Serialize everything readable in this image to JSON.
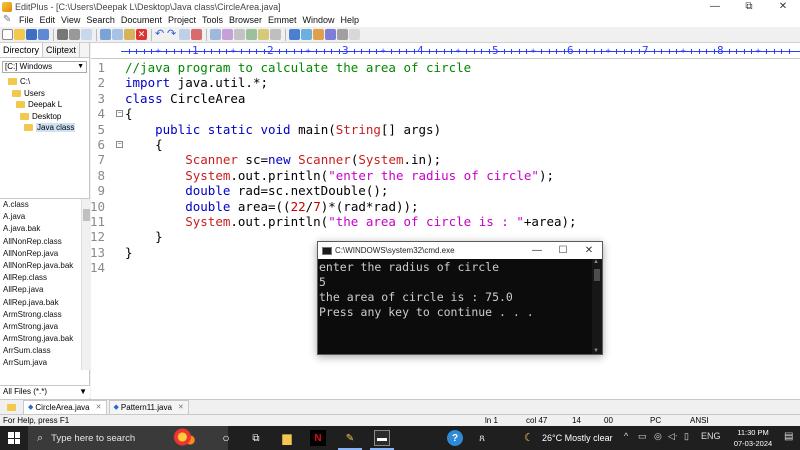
{
  "window": {
    "title": "EditPlus - [C:\\Users\\Deepak L\\Desktop\\Java class\\CircleArea.java]",
    "buttons": [
      "—",
      "⧉",
      "✕"
    ]
  },
  "menubar": [
    "File",
    "Edit",
    "View",
    "Search",
    "Document",
    "Project",
    "Tools",
    "Browser",
    "Emmet",
    "Window",
    "Help"
  ],
  "left_panel": {
    "tabs": [
      "Directory",
      "Cliptext"
    ],
    "drive": "[C:] Windows",
    "tree": [
      {
        "label": "C:\\",
        "indent": 0
      },
      {
        "label": "Users",
        "indent": 1
      },
      {
        "label": "Deepak L",
        "indent": 2
      },
      {
        "label": "Desktop",
        "indent": 3
      },
      {
        "label": "Java class",
        "indent": 4,
        "selected": true
      }
    ],
    "files": [
      "A.class",
      "A.java",
      "A.java.bak",
      "AllNonRep.class",
      "AllNonRep.java",
      "AllNonRep.java.bak",
      "AllRep.class",
      "AllRep.java",
      "AllRep.java.bak",
      "ArmStrong.class",
      "ArmStrong.java",
      "ArmStrong.java.bak",
      "ArrSum.class",
      "ArrSum.java"
    ],
    "filter": "All Files (*.*)"
  },
  "ruler": {
    "numbers": [
      "1",
      "2",
      "3",
      "4",
      "5",
      "6",
      "7",
      "8"
    ]
  },
  "editor": {
    "line_numbers": [
      "1",
      "2",
      "3",
      "4",
      "5",
      "6",
      "7",
      "8",
      "9",
      "10",
      "11",
      "12",
      "13",
      "14"
    ],
    "fold_lines": [
      4,
      6
    ],
    "lines": [
      [
        {
          "t": "//java program to calculate the area of circle",
          "c": "cmt"
        }
      ],
      [
        {
          "t": "import",
          "c": "kw"
        },
        {
          "t": " java.util.*;",
          "c": ""
        }
      ],
      [
        {
          "t": "class",
          "c": "kw"
        },
        {
          "t": " CircleArea",
          "c": ""
        }
      ],
      [
        {
          "t": "{",
          "c": ""
        }
      ],
      [
        {
          "t": "    ",
          "c": ""
        },
        {
          "t": "public",
          "c": "kw"
        },
        {
          "t": " ",
          "c": ""
        },
        {
          "t": "static",
          "c": "kw"
        },
        {
          "t": " ",
          "c": ""
        },
        {
          "t": "void",
          "c": "kw"
        },
        {
          "t": " main(",
          "c": ""
        },
        {
          "t": "String",
          "c": "cls"
        },
        {
          "t": "[] args)",
          "c": ""
        }
      ],
      [
        {
          "t": "    {",
          "c": ""
        }
      ],
      [
        {
          "t": "        ",
          "c": ""
        },
        {
          "t": "Scanner",
          "c": "cls"
        },
        {
          "t": " sc=",
          "c": ""
        },
        {
          "t": "new",
          "c": "kw"
        },
        {
          "t": " ",
          "c": ""
        },
        {
          "t": "Scanner",
          "c": "cls"
        },
        {
          "t": "(",
          "c": ""
        },
        {
          "t": "System",
          "c": "cls"
        },
        {
          "t": ".in);",
          "c": ""
        }
      ],
      [
        {
          "t": "        ",
          "c": ""
        },
        {
          "t": "System",
          "c": "cls"
        },
        {
          "t": ".out.println(",
          "c": ""
        },
        {
          "t": "\"enter the radius of circle\"",
          "c": "str"
        },
        {
          "t": ");",
          "c": ""
        }
      ],
      [
        {
          "t": "        ",
          "c": ""
        },
        {
          "t": "double",
          "c": "kw"
        },
        {
          "t": " rad=sc.nextDouble();",
          "c": ""
        }
      ],
      [
        {
          "t": "        ",
          "c": ""
        },
        {
          "t": "double",
          "c": "kw"
        },
        {
          "t": " area=((",
          "c": ""
        },
        {
          "t": "22",
          "c": "num"
        },
        {
          "t": "/",
          "c": ""
        },
        {
          "t": "7",
          "c": "num"
        },
        {
          "t": ")*(rad*rad));",
          "c": ""
        }
      ],
      [
        {
          "t": "        ",
          "c": ""
        },
        {
          "t": "System",
          "c": "cls"
        },
        {
          "t": ".out.println(",
          "c": ""
        },
        {
          "t": "\"the area of circle is : \"",
          "c": "str"
        },
        {
          "t": "+area);",
          "c": ""
        }
      ],
      [
        {
          "t": "    }",
          "c": ""
        }
      ],
      [
        {
          "t": "}",
          "c": ""
        }
      ],
      [
        {
          "t": "",
          "c": ""
        }
      ]
    ]
  },
  "console": {
    "title": "C:\\WINDOWS\\system32\\cmd.exe",
    "lines": [
      "enter the radius of circle",
      "5",
      "the area of circle is : 75.0",
      "Press any key to continue . . ."
    ]
  },
  "doc_tabs": [
    {
      "label": "CircleArea.java",
      "active": true
    },
    {
      "label": "Pattern11.java",
      "active": false
    }
  ],
  "status": {
    "help": "For Help, press F1",
    "ln": "ln 1",
    "col": "col 47",
    "n1": "14",
    "n2": "00",
    "encoding": "PC",
    "charset": "ANSI"
  },
  "taskbar": {
    "search_placeholder": "Type here to search",
    "weather": "26°C  Mostly clear",
    "lang": "ENG",
    "time": "11:30 PM",
    "date": "07-03-2024"
  },
  "colors": {
    "keyword": "#0000c8",
    "comment": "#008800",
    "class": "#c81e1e",
    "string": "#c800c8",
    "number": "#c80000",
    "ruler": "#2a3cff"
  }
}
